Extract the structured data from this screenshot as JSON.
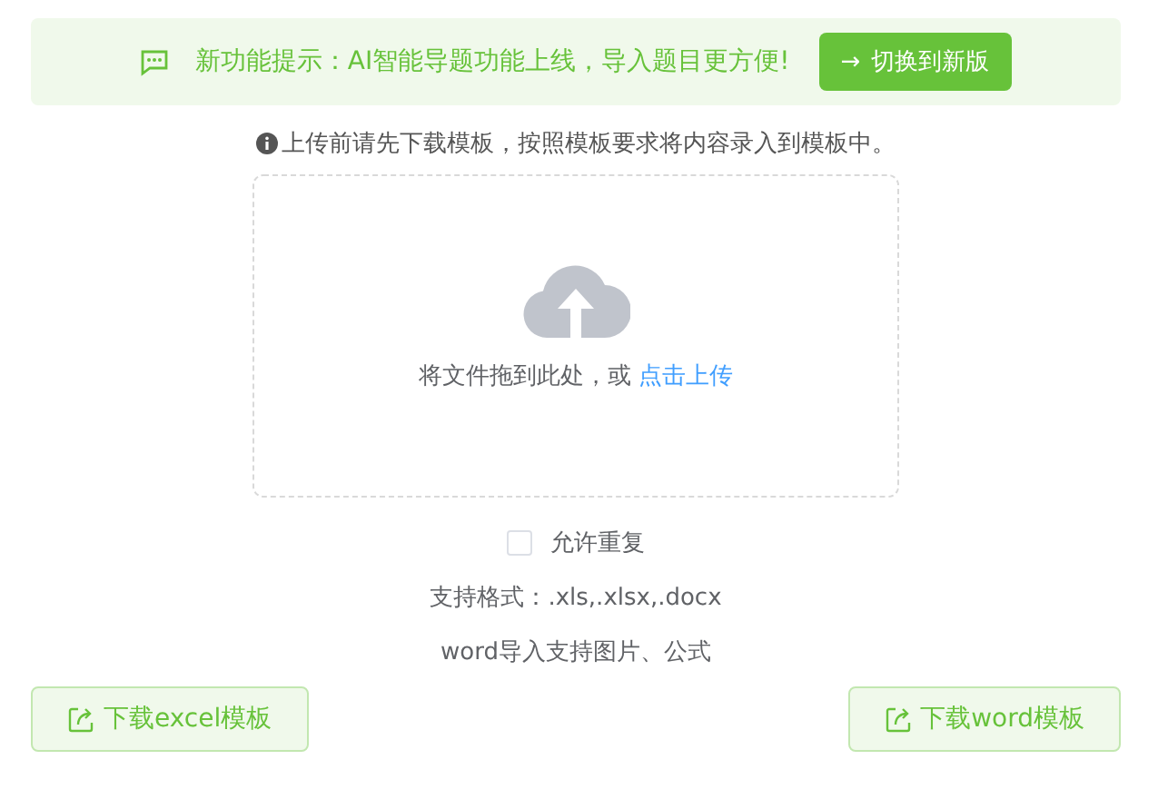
{
  "banner": {
    "text": "新功能提示：AI智能导题功能上线，导入题目更方便!",
    "button": {
      "arrow": "→",
      "label": "切换到新版"
    }
  },
  "notice": "上传前请先下载模板，按照模板要求将内容录入到模板中。",
  "upload": {
    "hint": "将文件拖到此处，或 ",
    "link": "点击上传"
  },
  "allow_duplicates": {
    "label": "允许重复",
    "checked": false
  },
  "formats": "支持格式：.xls,.xlsx,.docx",
  "word_note": "word导入支持图片、公式",
  "buttons": [
    {
      "label": "下载excel模板"
    },
    {
      "label": "下载word模板"
    }
  ]
}
